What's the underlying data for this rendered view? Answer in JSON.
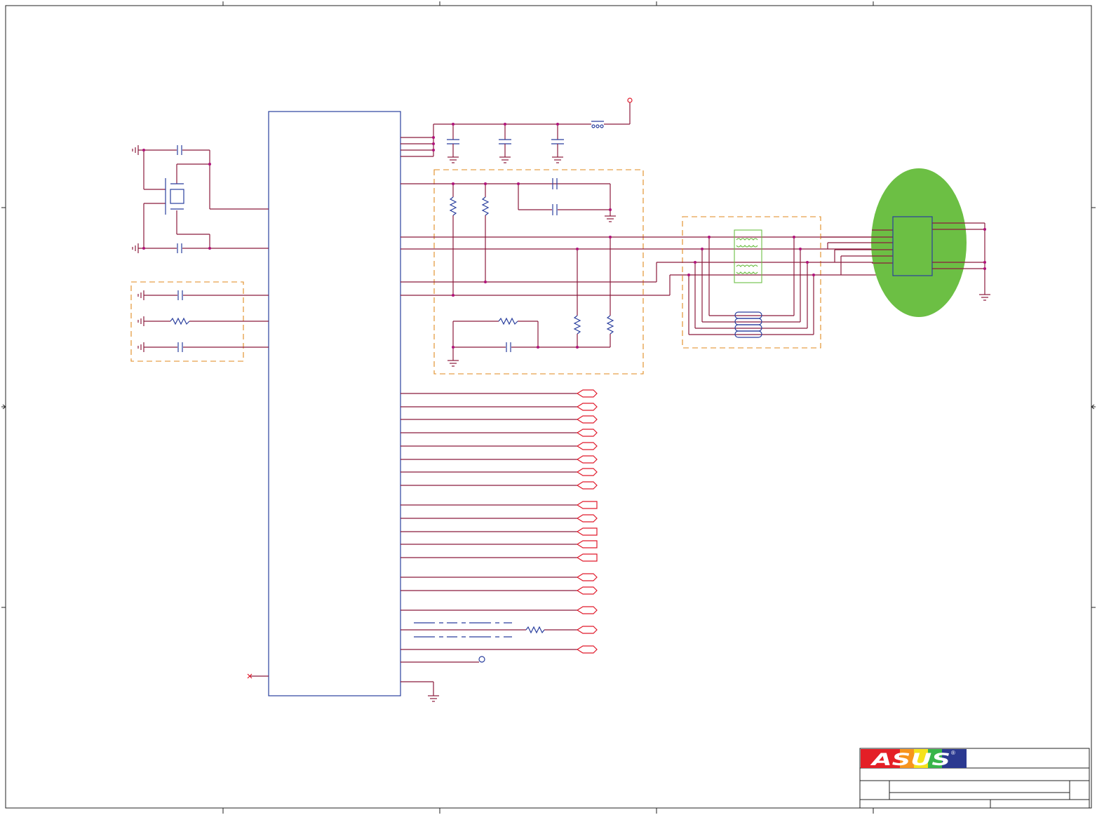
{
  "title_block": {
    "brand": "ASUS",
    "brand_mark": "®",
    "brand_colors": {
      "red": "#e41f26",
      "blue": "#2b3990",
      "rainbow_orange": "#f7941d",
      "rainbow_green": "#39b54a"
    }
  },
  "colors": {
    "wire": "#8b1a3c",
    "component": "#2a3f9e",
    "port": "#e0192a",
    "group_border": "#e08a1e",
    "connector_highlight": "#6cbf44"
  },
  "icons": [
    "ground-icon",
    "capacitor-icon",
    "resistor-icon",
    "crystal-icon",
    "ferrite-bead-icon",
    "transformer-icon",
    "port-arrow-icon",
    "test-point-icon"
  ]
}
